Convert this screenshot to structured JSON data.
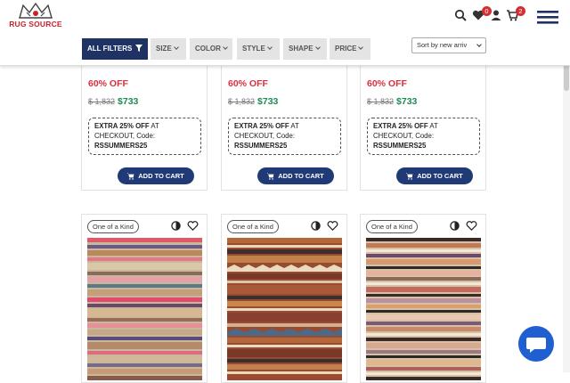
{
  "brand": {
    "logo_text": "RUG SOURCE",
    "color": "#c8232c"
  },
  "header": {
    "icons": [
      "search-icon",
      "heart-icon",
      "user-icon",
      "cart-icon",
      "menu-icon"
    ],
    "wishlist_count": "0",
    "cart_count": "2"
  },
  "filters": {
    "all_filters": "ALL FILTERS",
    "size": "SIZE",
    "color": "COLOR",
    "style": "STYLE",
    "shape": "SHAPE",
    "price": "PRICE",
    "sort": "Sort by new arriv"
  },
  "products_top": [
    {
      "discount": "60% OFF",
      "old_price": "$ 1,832",
      "new_price": "$733",
      "coupon_line1": "EXTRA 25% OFF",
      "coupon_line1b": " AT",
      "coupon_line2": "CHECKOUT, Code:",
      "coupon_code": "RSSUMMERS25",
      "button": "ADD TO CART"
    },
    {
      "discount": "60% OFF",
      "old_price": "$ 1,832",
      "new_price": "$733",
      "coupon_line1": "EXTRA 25% OFF",
      "coupon_line1b": " AT",
      "coupon_line2": "CHECKOUT, Code:",
      "coupon_code": "RSSUMMERS25",
      "button": "ADD TO CART"
    },
    {
      "discount": "60% OFF",
      "old_price": "$ 1,832",
      "new_price": "$733",
      "coupon_line1": "EXTRA 25% OFF",
      "coupon_line1b": " AT",
      "coupon_line2": "CHECKOUT, Code:",
      "coupon_code": "RSSUMMERS25",
      "button": "ADD TO CART"
    }
  ],
  "products_bottom": [
    {
      "tag": "One of a Kind"
    },
    {
      "tag": "One of a Kind"
    },
    {
      "tag": "One of a Kind"
    }
  ],
  "colors": {
    "navy": "#1f3264",
    "button": "#1f3a76",
    "discount": "#d9303f",
    "price": "#1e8a55",
    "chat": "#1f5fd0"
  }
}
